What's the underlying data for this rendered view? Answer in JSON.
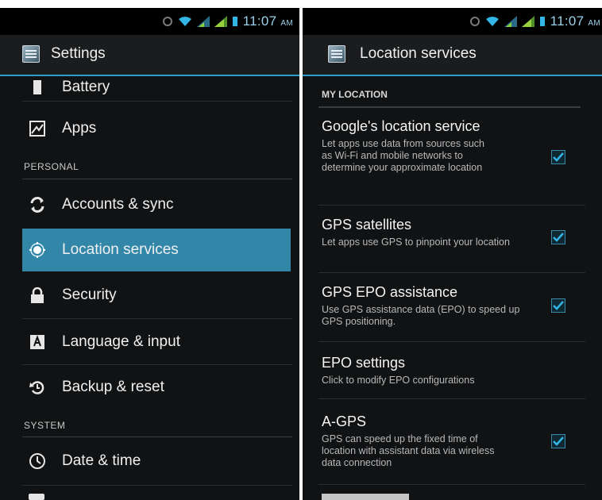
{
  "status_bar": {
    "time_left": "11:07",
    "ampm_left": "AM",
    "time_right": "11:07",
    "ampm_right": "AM"
  },
  "left_screen": {
    "title": "Settings",
    "items": [
      {
        "label": "Battery",
        "icon": "battery-icon"
      },
      {
        "label": "Apps",
        "icon": "apps-icon"
      },
      {
        "header": "PERSONAL"
      },
      {
        "label": "Accounts & sync",
        "icon": "sync-icon"
      },
      {
        "label": "Location services",
        "icon": "location-icon",
        "selected": true
      },
      {
        "label": "Security",
        "icon": "lock-icon"
      },
      {
        "label": "Language & input",
        "icon": "keyboard-icon"
      },
      {
        "label": "Backup & reset",
        "icon": "backup-icon"
      },
      {
        "header": "SYSTEM"
      },
      {
        "label": "Date & time",
        "icon": "clock-icon"
      }
    ]
  },
  "right_screen": {
    "title": "Location services",
    "section_header": "MY LOCATION",
    "items": [
      {
        "title": "Google's location service",
        "summary": "Let apps use data from sources such as Wi-Fi and mobile networks to determine your approximate location",
        "checked": true
      },
      {
        "title": "GPS satellites",
        "summary": "Let apps use GPS to pinpoint your location",
        "checked": true
      },
      {
        "title": "GPS EPO assistance",
        "summary": "Use GPS assistance data (EPO) to speed up GPS positioning.",
        "checked": true
      },
      {
        "title": "EPO settings",
        "summary": "Click to modify EPO configurations"
      },
      {
        "title": "A-GPS",
        "summary": "GPS can speed up the fixed time of location with assistant data via wireless data connection",
        "checked": true
      }
    ]
  },
  "colors": {
    "accent": "#33b5e5",
    "selected_row": "#3287a9",
    "background": "#101214"
  }
}
